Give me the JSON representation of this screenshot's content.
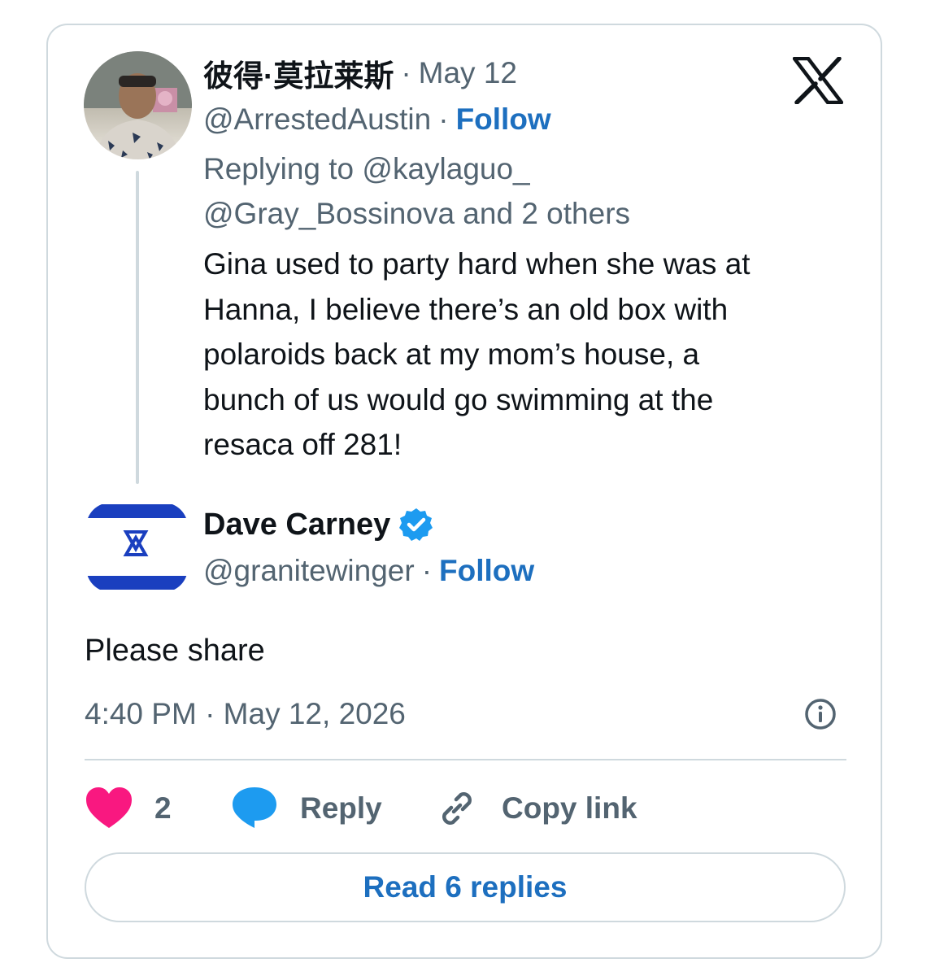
{
  "brand_logo": "x-logo-icon",
  "colors": {
    "link_blue": "#1d6fbf",
    "muted_gray": "#536471",
    "border_gray": "#cfd9de",
    "heart_pink": "#f91880",
    "bubble_blue": "#1d9bf0",
    "flag_blue": "#1a3fbf"
  },
  "parent_tweet": {
    "display_name": "彼得·莫拉莱斯",
    "separator": "·",
    "date": "May 12",
    "handle": "@ArrestedAustin",
    "follow_label": "Follow",
    "replying_line1": "Replying to @kaylaguo_",
    "replying_line2": "@Gray_Bossinova and 2 others",
    "text_lines": [
      "Gina used to party hard when she was at",
      "Hanna, I believe there’s an old box with",
      "polaroids back at my mom’s house, a",
      "bunch of us would go swimming at the",
      "resaca off 281!"
    ]
  },
  "main_tweet": {
    "display_name": "Dave Carney",
    "verified_icon": "verified-badge-icon",
    "handle": "@granitewinger",
    "separator": "·",
    "follow_label": "Follow",
    "text": "Please share",
    "timestamp": "4:40 PM · May 12, 2026"
  },
  "actions": {
    "like_count": "2",
    "reply_label": "Reply",
    "copy_link_label": "Copy link"
  },
  "read_replies_label": "Read 6 replies"
}
